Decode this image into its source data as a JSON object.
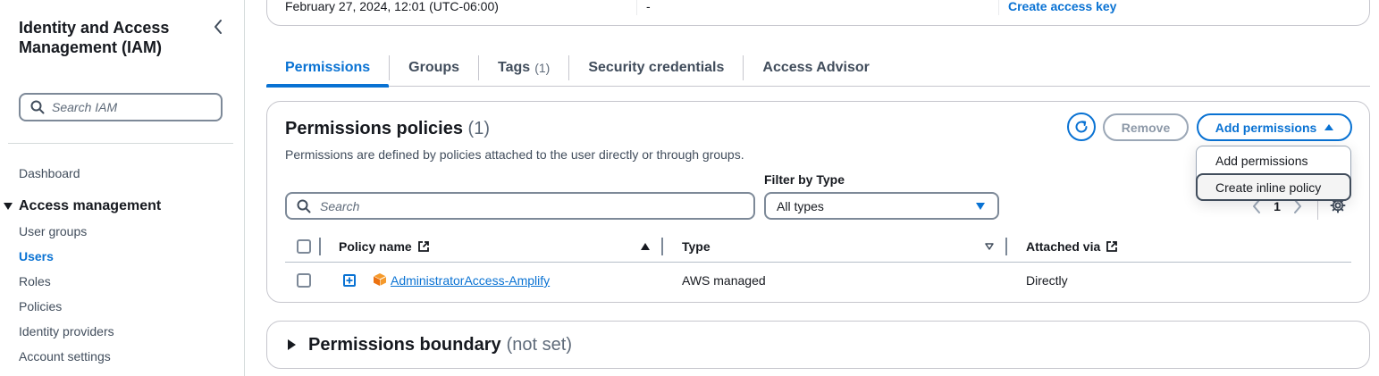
{
  "sidebar": {
    "title": "Identity and Access Management (IAM)",
    "search_placeholder": "Search IAM",
    "dashboard": "Dashboard",
    "section": "Access management",
    "items": [
      "User groups",
      "Users",
      "Roles",
      "Policies",
      "Identity providers",
      "Account settings"
    ],
    "active_item": "Users"
  },
  "summary": {
    "created": "February 27, 2024, 12:01 (UTC-06:00)",
    "dash": "-",
    "access_key_link": "Create access key"
  },
  "tabs": [
    {
      "label": "Permissions",
      "count": ""
    },
    {
      "label": "Groups",
      "count": ""
    },
    {
      "label": "Tags",
      "count": "(1)"
    },
    {
      "label": "Security credentials",
      "count": ""
    },
    {
      "label": "Access Advisor",
      "count": ""
    }
  ],
  "active_tab": "Permissions",
  "permissions": {
    "title": "Permissions policies",
    "count": "(1)",
    "description": "Permissions are defined by policies attached to the user directly or through groups.",
    "remove_label": "Remove",
    "add_label": "Add permissions",
    "menu": [
      "Add permissions",
      "Create inline policy"
    ],
    "menu_highlighted": "Create inline policy",
    "search_placeholder": "Search",
    "filter_label": "Filter by Type",
    "filter_value": "All types",
    "page": "1",
    "columns": {
      "policy": "Policy name",
      "type": "Type",
      "attached": "Attached via"
    },
    "rows": [
      {
        "policy": "AdministratorAccess-Amplify",
        "type": "AWS managed",
        "attached": "Directly"
      }
    ]
  },
  "boundary": {
    "title": "Permissions boundary",
    "status": "(not set)"
  },
  "colors": {
    "accent": "#0972d3",
    "text": "#16191f",
    "muted": "#5f6b7a",
    "border": "#c6c6cd",
    "policy_icon": "#ec7211"
  }
}
